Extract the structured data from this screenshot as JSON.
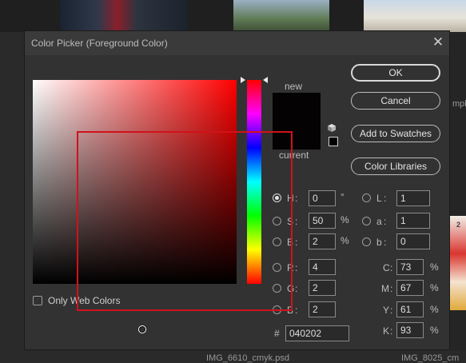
{
  "background": {
    "file_left": "IMG_6610_cmyk.psd",
    "file_right": "IMG_8025_cm",
    "panel_fragment": "mpk",
    "badge": "2"
  },
  "dialog": {
    "title": "Color Picker (Foreground Color)",
    "close_icon": "close-icon",
    "label_new": "new",
    "label_current": "current",
    "new_color": "#040202",
    "current_color": "#040202",
    "buttons": {
      "ok": "OK",
      "cancel": "Cancel",
      "add_to_swatches": "Add to Swatches",
      "color_libraries": "Color Libraries"
    },
    "hsb": [
      {
        "key": "H",
        "value": "0",
        "unit": "°",
        "selected": true
      },
      {
        "key": "S",
        "value": "50",
        "unit": "%",
        "selected": false
      },
      {
        "key": "B",
        "value": "2",
        "unit": "%",
        "selected": false
      }
    ],
    "rgb": [
      {
        "key": "R",
        "value": "4"
      },
      {
        "key": "G",
        "value": "2"
      },
      {
        "key": "B",
        "value": "2"
      }
    ],
    "lab": [
      {
        "key": "L",
        "value": "1"
      },
      {
        "key": "a",
        "value": "1"
      },
      {
        "key": "b",
        "value": "0"
      }
    ],
    "cmyk": [
      {
        "key": "C",
        "value": "73",
        "unit": "%"
      },
      {
        "key": "M",
        "value": "67",
        "unit": "%"
      },
      {
        "key": "Y",
        "value": "61",
        "unit": "%"
      },
      {
        "key": "K",
        "value": "93",
        "unit": "%"
      }
    ],
    "hex_symbol": "#",
    "hex": "040202",
    "only_web_colors_label": "Only Web Colors",
    "only_web_colors_checked": false
  },
  "colors": {
    "dialog_bg": "#323232",
    "annotation": "#d0121a",
    "hue": "#ff0000"
  }
}
